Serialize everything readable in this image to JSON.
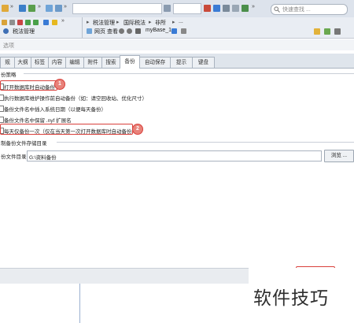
{
  "toolbar": {
    "more_glyph": "»",
    "address_items": [
      "税法管理",
      "国际税法",
      "非所"
    ],
    "search_placeholder": "快速查找 ...",
    "tree_item": "税法管理",
    "view_label": "网页 查看",
    "db_name": "myBase_1",
    "ellipsis": "..."
  },
  "section_title": "选项",
  "tabs": [
    {
      "label": "规"
    },
    {
      "label": "大纲"
    },
    {
      "label": "标签"
    },
    {
      "label": "内容"
    },
    {
      "label": "编辑"
    },
    {
      "label": "附件"
    },
    {
      "label": "搜索"
    },
    {
      "label": "备份",
      "active": true
    },
    {
      "label": "自动保存"
    },
    {
      "label": "提示"
    },
    {
      "label": "键盘"
    }
  ],
  "backup": {
    "group_title": "份策略",
    "options": [
      {
        "label": "打开数据库时自动备份",
        "checked": false,
        "highlight": true,
        "badge": "1"
      },
      {
        "label": "执行数据库维护操作前自动备份（如：请空回收站、优化尺寸）",
        "checked": false
      },
      {
        "label": "备份文件名中插入系统日期（以便每天备份）",
        "checked": false
      },
      {
        "label": "备份文件名中保留 .nyf 扩展名",
        "checked": false
      },
      {
        "label": "每天仅备份一次（仅在当天第一次打开数据库时自动备份）",
        "checked": false,
        "highlight": true,
        "badge": "2"
      }
    ],
    "dir_group_title": "制备份文件存储目录",
    "dir_label": "份文件目录",
    "dir_value": "G:\\资料备份",
    "browse_label": "浏览 ..."
  },
  "watermark": "软件技巧",
  "colors": {
    "highlight_red": "#d9403b",
    "badge_fill": "#e8827a",
    "toolbar_bg": "#dde3ec"
  }
}
